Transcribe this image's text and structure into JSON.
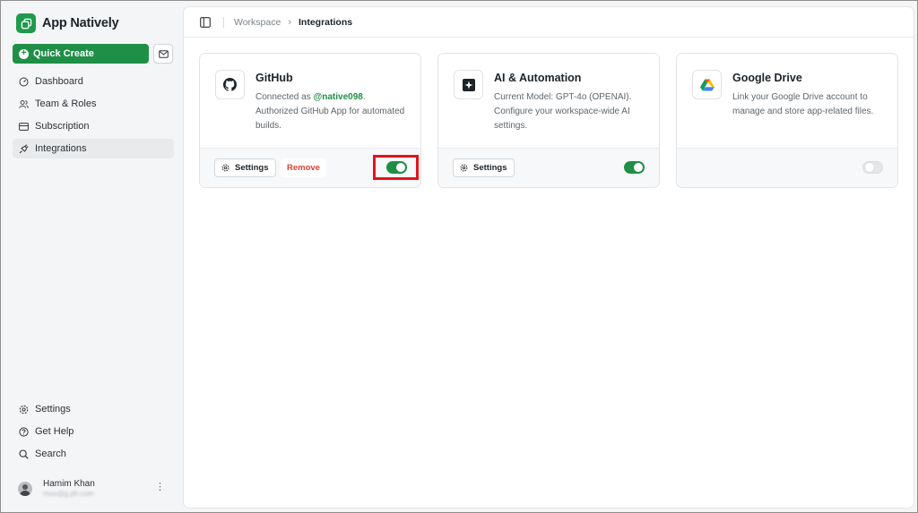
{
  "app": {
    "name": "App Natively",
    "brand_color": "#1f9a4d"
  },
  "sidebar": {
    "quick_create_label": "Quick Create",
    "items": [
      {
        "label": "Dashboard",
        "icon": "gauge-icon"
      },
      {
        "label": "Team & Roles",
        "icon": "users-icon"
      },
      {
        "label": "Subscription",
        "icon": "card-icon"
      },
      {
        "label": "Integrations",
        "icon": "plug-icon",
        "active": true
      }
    ],
    "bottom_items": [
      {
        "label": "Settings",
        "icon": "gear-icon"
      },
      {
        "label": "Get Help",
        "icon": "help-circle-icon"
      },
      {
        "label": "Search",
        "icon": "search-icon"
      }
    ],
    "user": {
      "name": "Hamim Khan",
      "email": "moo@g.ph.com"
    }
  },
  "header": {
    "breadcrumb": [
      "Workspace",
      "Integrations"
    ],
    "separator": "›"
  },
  "integrations": [
    {
      "title": "GitHub",
      "icon": "github-icon",
      "desc_prefix": "Connected as ",
      "handle": "@native098",
      "desc_suffix": ". Authorized GitHub App for automated builds.",
      "settings_label": "Settings",
      "remove_label": "Remove",
      "enabled": true
    },
    {
      "title": "AI & Automation",
      "icon": "sparkle-icon",
      "description": "Current Model: GPT-4o (OPENAI). Configure your workspace-wide AI settings.",
      "settings_label": "Settings",
      "enabled": true
    },
    {
      "title": "Google Drive",
      "icon": "google-drive-icon",
      "description": "Link your Google Drive account to manage and store app-related files.",
      "enabled": false
    }
  ],
  "colors": {
    "accent": "#1f8f47",
    "danger": "#e0412e",
    "highlight": "#e3141b"
  }
}
